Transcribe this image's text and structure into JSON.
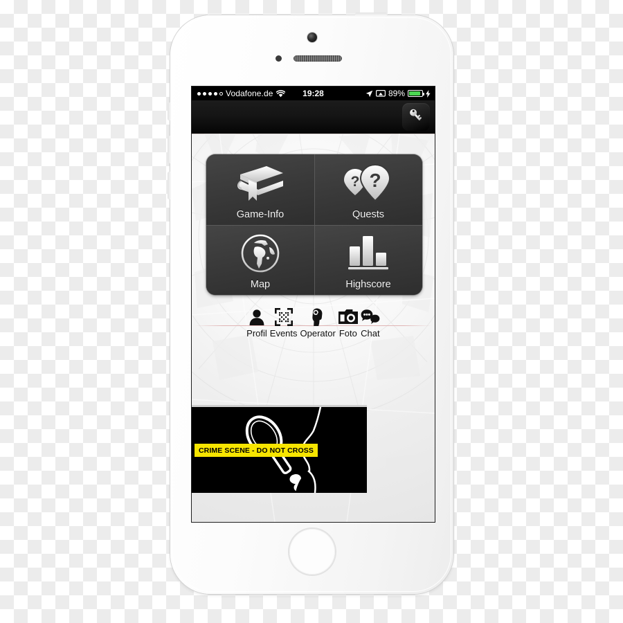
{
  "device": {
    "name": "iphone-5s-white",
    "frame_color": "#f4f4f4"
  },
  "status_bar": {
    "signal_dots_filled": 4,
    "signal_dots_total": 5,
    "carrier": "Vodafone.de",
    "wifi_icon": "wifi-icon",
    "time": "19:28",
    "location_icon": "location-arrow-icon",
    "airplay_icon": "airplay-icon",
    "battery_percent": "89%",
    "battery_level": 89,
    "battery_color": "#4cd552",
    "charging_icon": "lightning-bolt-icon"
  },
  "nav_bar": {
    "key_button_icon": "key-icon",
    "key_button_label": "Key"
  },
  "grid": {
    "tiles": [
      {
        "label": "Game-Info",
        "icon": "book-icon"
      },
      {
        "label": "Quests",
        "icon": "map-pin-question-icon"
      },
      {
        "label": "Map",
        "icon": "globe-icon"
      },
      {
        "label": "Highscore",
        "icon": "bar-chart-icon"
      }
    ]
  },
  "toolbar": {
    "items": [
      {
        "label": "Profil",
        "icon": "person-icon"
      },
      {
        "label": "Events",
        "icon": "qr-code-scan-icon"
      },
      {
        "label": "Operator",
        "icon": "detective-head-icon"
      },
      {
        "label": "Foto",
        "icon": "camera-icon"
      },
      {
        "label": "Chat",
        "icon": "speech-bubbles-icon"
      }
    ]
  },
  "banner": {
    "tape_text": "CRIME SCENE - DO NOT CROSS",
    "tape_color": "#f7e500",
    "background_color": "#000000",
    "artwork": "detective-silhouette-with-magnifier"
  },
  "colors": {
    "tile_bg": "#3a3a3a",
    "screen_bg": "#ffffff",
    "status_bar_bg": "#000000",
    "rule_color": "#e0b4b4"
  }
}
